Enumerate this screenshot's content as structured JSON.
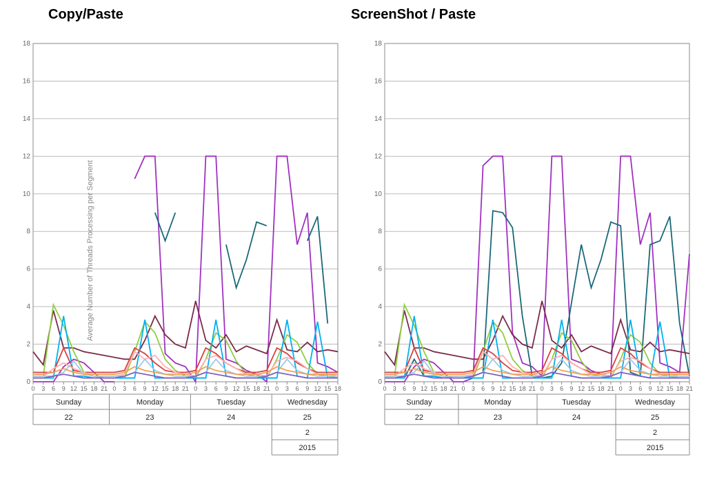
{
  "titles": {
    "left": "Copy/Paste",
    "right": "ScreenShot / Paste"
  },
  "ylabel": "Average Number of Threads Processing per Segment",
  "chart_data": [
    {
      "type": "line",
      "title": "Copy/Paste",
      "ylabel": "Average Number of Threads Processing per Segment",
      "ylim": [
        0,
        18
      ],
      "y_ticks": [
        0,
        2,
        4,
        6,
        8,
        10,
        12,
        14,
        16,
        18
      ],
      "x_hours_per_day": [
        0,
        3,
        6,
        9,
        12,
        15,
        18,
        21
      ],
      "x_hours_last_day": [
        0,
        3,
        6,
        9,
        12,
        15,
        18
      ],
      "days": [
        {
          "name": "Sunday",
          "num": "22"
        },
        {
          "name": "Monday",
          "num": "23"
        },
        {
          "name": "Tuesday",
          "num": "24"
        },
        {
          "name": "Wednesday",
          "num": "25"
        }
      ],
      "month": "2",
      "year": "2015",
      "series": [
        {
          "name": "purple-spike",
          "color": "#a030c0",
          "values": [
            0,
            0,
            0,
            0.8,
            1.2,
            1,
            0.5,
            0,
            0,
            null,
            10.8,
            12,
            12,
            1.5,
            1,
            0.8,
            0,
            12,
            12,
            1.2,
            1,
            0.6,
            0.4,
            0,
            12,
            12,
            7.3,
            9,
            1,
            0.8,
            0.5
          ]
        },
        {
          "name": "teal-dark",
          "color": "#1a6878",
          "values": [
            null,
            null,
            null,
            null,
            null,
            null,
            null,
            null,
            null,
            null,
            null,
            null,
            9,
            7.5,
            9,
            null,
            null,
            null,
            null,
            7.3,
            5,
            6.5,
            8.5,
            8.3,
            null,
            null,
            null,
            7.5,
            8.8,
            3.1,
            null
          ]
        },
        {
          "name": "dark-red",
          "color": "#7a2b48",
          "values": [
            1.6,
            0.9,
            3.8,
            1.8,
            1.8,
            1.6,
            1.5,
            1.4,
            1.3,
            1.2,
            1.2,
            2.2,
            3.5,
            2.5,
            2,
            1.8,
            4.3,
            2.2,
            1.8,
            2.5,
            1.6,
            1.9,
            1.7,
            1.5,
            3.3,
            1.7,
            1.6,
            2.1,
            1.6,
            1.7,
            1.6
          ]
        },
        {
          "name": "green",
          "color": "#8fce3f",
          "values": [
            0.3,
            0.3,
            4.1,
            3,
            1.6,
            0.5,
            0.3,
            0.2,
            0.2,
            0.2,
            1.6,
            3.2,
            2.6,
            1.2,
            0.6,
            0.3,
            0.2,
            1.2,
            2.6,
            2.2,
            1.1,
            0.4,
            0.3,
            0.2,
            1.2,
            2.5,
            2.1,
            1.0,
            0.4,
            0.3,
            0.2
          ]
        },
        {
          "name": "cyan",
          "color": "#00b0f0",
          "values": [
            0.2,
            0.2,
            0.2,
            3.5,
            0.3,
            0.3,
            0.2,
            0.2,
            0.2,
            0.2,
            0.2,
            3.3,
            0.2,
            0.2,
            0.2,
            0.2,
            0.2,
            0.2,
            3.3,
            0.3,
            0.2,
            0.2,
            0.2,
            0.2,
            0.2,
            3.3,
            0.3,
            0.2,
            3.2,
            0.2,
            0.2
          ]
        },
        {
          "name": "red",
          "color": "#d94040",
          "values": [
            0.5,
            0.5,
            0.5,
            1.8,
            0.6,
            0.5,
            0.5,
            0.5,
            0.5,
            0.6,
            1.8,
            1.5,
            1.0,
            0.6,
            0.5,
            0.5,
            0.6,
            1.8,
            1.5,
            1.0,
            0.7,
            0.5,
            0.5,
            0.6,
            1.8,
            1.5,
            1.0,
            0.7,
            0.5,
            0.5,
            0.5
          ]
        },
        {
          "name": "pink",
          "color": "#ffb0b0",
          "values": [
            0.3,
            0.3,
            0.7,
            1.0,
            0.7,
            0.5,
            0.3,
            0.3,
            0.3,
            0.4,
            1.6,
            1.2,
            1.4,
            0.8,
            0.5,
            0.4,
            0.3,
            1.2,
            1.4,
            1.0,
            0.7,
            0.4,
            0.4,
            0.3,
            1.1,
            1.3,
            1.1,
            0.7,
            0.4,
            0.4,
            0.3
          ]
        },
        {
          "name": "light-blue",
          "color": "#a0c8e8",
          "values": [
            0.3,
            0.3,
            0.3,
            0.5,
            1.1,
            0.4,
            0.3,
            0.3,
            0.3,
            0.3,
            0.5,
            1.2,
            0.6,
            0.4,
            0.3,
            0.3,
            0.3,
            0.5,
            1.2,
            0.6,
            0.4,
            0.3,
            0.3,
            0.3,
            0.5,
            1.2,
            0.6,
            0.4,
            0.3,
            0.3,
            0.3
          ]
        },
        {
          "name": "orange",
          "color": "#f0a050",
          "values": [
            0.4,
            0.4,
            0.5,
            0.7,
            0.5,
            0.4,
            0.4,
            0.4,
            0.4,
            0.5,
            0.8,
            0.6,
            0.5,
            0.4,
            0.4,
            0.4,
            0.5,
            0.8,
            0.6,
            0.5,
            0.4,
            0.4,
            0.4,
            0.5,
            0.8,
            0.6,
            0.5,
            0.4,
            0.4,
            0.4,
            0.4
          ]
        },
        {
          "name": "violet",
          "color": "#8060c0",
          "values": [
            0.2,
            0.2,
            0.3,
            0.4,
            0.3,
            0.2,
            0.2,
            0.2,
            0.2,
            0.3,
            0.5,
            0.4,
            0.3,
            0.2,
            0.2,
            0.2,
            0.3,
            0.5,
            0.4,
            0.3,
            0.2,
            0.2,
            0.2,
            0.3,
            0.5,
            0.4,
            0.3,
            0.2,
            0.2,
            0.2,
            0.2
          ]
        }
      ]
    },
    {
      "type": "line",
      "title": "ScreenShot / Paste",
      "ylabel": "Average Number of Threads Processing per Segment",
      "ylim": [
        0,
        18
      ],
      "y_ticks": [
        0,
        2,
        4,
        6,
        8,
        10,
        12,
        14,
        16,
        18
      ],
      "x_hours_per_day": [
        0,
        3,
        6,
        9,
        12,
        15,
        18,
        21
      ],
      "days": [
        {
          "name": "Sunday",
          "num": "22"
        },
        {
          "name": "Monday",
          "num": "23"
        },
        {
          "name": "Tuesday",
          "num": "24"
        },
        {
          "name": "Wednesday",
          "num": "25"
        }
      ],
      "month": "2",
      "year": "2015",
      "series": [
        {
          "name": "purple-spike",
          "color": "#a030c0",
          "values": [
            0,
            0,
            0,
            0.8,
            1.2,
            1,
            0.5,
            0,
            0,
            0.2,
            11.5,
            12,
            12,
            2.6,
            1,
            0.8,
            0.3,
            12,
            12,
            1.2,
            1,
            0.6,
            0.4,
            0.3,
            12,
            12,
            7.3,
            9,
            1,
            0.8,
            0.5,
            6.8
          ]
        },
        {
          "name": "teal-dark",
          "color": "#1a6878",
          "values": [
            0.2,
            0.2,
            0.2,
            1.2,
            0.3,
            0.3,
            0.2,
            0.2,
            0.2,
            0.3,
            0.5,
            9.1,
            9,
            8.2,
            3.5,
            0.3,
            0.2,
            0.3,
            1.0,
            4.2,
            7.3,
            5,
            6.5,
            8.5,
            8.3,
            0.5,
            0.3,
            7.3,
            7.5,
            8.8,
            3.1,
            0.3
          ]
        },
        {
          "name": "dark-red",
          "color": "#7a2b48",
          "values": [
            1.6,
            0.9,
            3.8,
            1.8,
            1.8,
            1.6,
            1.5,
            1.4,
            1.3,
            1.2,
            1.2,
            2.2,
            3.5,
            2.5,
            2,
            1.8,
            4.3,
            2.2,
            1.8,
            2.5,
            1.6,
            1.9,
            1.7,
            1.5,
            3.3,
            1.7,
            1.6,
            2.1,
            1.6,
            1.7,
            1.6,
            1.5
          ]
        },
        {
          "name": "green",
          "color": "#8fce3f",
          "values": [
            0.3,
            0.3,
            4.1,
            3,
            1.6,
            0.5,
            0.3,
            0.2,
            0.2,
            0.2,
            1.6,
            3.2,
            2.6,
            1.2,
            0.6,
            0.3,
            0.2,
            1.2,
            2.6,
            2.2,
            1.1,
            0.4,
            0.3,
            0.2,
            1.2,
            2.5,
            2.1,
            1.0,
            0.4,
            0.3,
            0.2,
            0.2
          ]
        },
        {
          "name": "cyan",
          "color": "#00b0f0",
          "values": [
            0.2,
            0.2,
            0.2,
            3.5,
            0.3,
            0.3,
            0.2,
            0.2,
            0.2,
            0.2,
            0.2,
            3.3,
            0.2,
            0.2,
            0.2,
            0.2,
            0.2,
            0.2,
            3.3,
            0.3,
            0.2,
            0.2,
            0.2,
            0.2,
            0.2,
            3.3,
            0.3,
            0.2,
            3.2,
            0.2,
            0.2,
            0.2
          ]
        },
        {
          "name": "red",
          "color": "#d94040",
          "values": [
            0.5,
            0.5,
            0.5,
            1.8,
            0.6,
            0.5,
            0.5,
            0.5,
            0.5,
            0.6,
            1.8,
            1.5,
            1.0,
            0.6,
            0.5,
            0.5,
            0.6,
            1.8,
            1.5,
            1.0,
            0.7,
            0.5,
            0.5,
            0.6,
            1.8,
            1.5,
            1.0,
            0.7,
            0.5,
            0.5,
            0.5,
            0.5
          ]
        },
        {
          "name": "pink",
          "color": "#ffb0b0",
          "values": [
            0.3,
            0.3,
            0.7,
            1.0,
            0.7,
            0.5,
            0.3,
            0.3,
            0.3,
            0.4,
            1.6,
            1.2,
            1.4,
            0.8,
            0.5,
            0.4,
            0.3,
            1.2,
            1.4,
            1.0,
            0.7,
            0.4,
            0.4,
            0.3,
            1.1,
            1.3,
            1.1,
            0.7,
            0.4,
            0.4,
            0.3,
            0.3
          ]
        },
        {
          "name": "light-blue",
          "color": "#a0c8e8",
          "values": [
            0.3,
            0.3,
            0.3,
            0.5,
            1.1,
            0.4,
            0.3,
            0.3,
            0.3,
            0.3,
            0.5,
            1.2,
            0.6,
            0.4,
            0.3,
            0.3,
            0.3,
            0.5,
            1.2,
            0.6,
            0.4,
            0.3,
            0.3,
            0.3,
            0.5,
            1.2,
            0.6,
            0.4,
            0.3,
            0.3,
            0.3,
            0.3
          ]
        },
        {
          "name": "orange",
          "color": "#f0a050",
          "values": [
            0.4,
            0.4,
            0.5,
            0.7,
            0.5,
            0.4,
            0.4,
            0.4,
            0.4,
            0.5,
            0.8,
            0.6,
            0.5,
            0.4,
            0.4,
            0.4,
            0.5,
            0.8,
            0.6,
            0.5,
            0.4,
            0.4,
            0.4,
            0.5,
            0.8,
            0.6,
            0.5,
            0.4,
            0.4,
            0.4,
            0.4,
            0.4
          ]
        },
        {
          "name": "violet",
          "color": "#8060c0",
          "values": [
            0.2,
            0.2,
            0.3,
            0.4,
            0.3,
            0.2,
            0.2,
            0.2,
            0.2,
            0.3,
            0.5,
            0.4,
            0.3,
            0.2,
            0.2,
            0.2,
            0.3,
            0.5,
            0.4,
            0.3,
            0.2,
            0.2,
            0.2,
            0.3,
            0.5,
            0.4,
            0.3,
            0.2,
            0.2,
            0.2,
            0.2,
            0.2
          ]
        }
      ]
    }
  ]
}
